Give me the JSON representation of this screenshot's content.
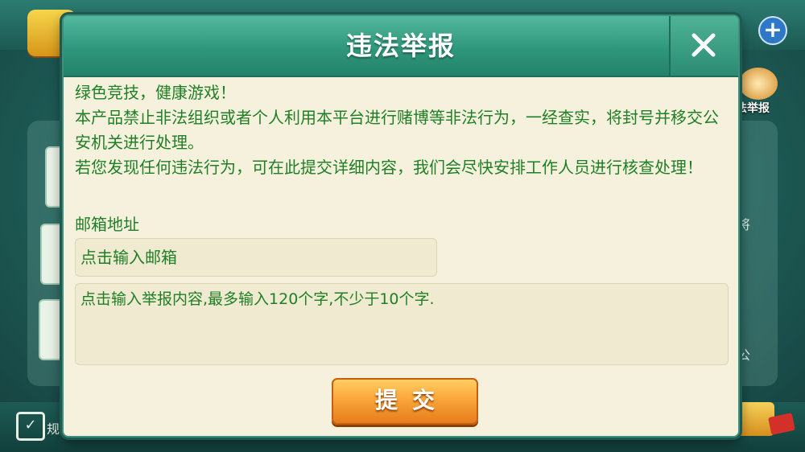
{
  "dialog": {
    "title": "违法举报",
    "intro_lines": [
      "绿色竞技，健康游戏！",
      "本产品禁止非法组织或者个人利用本平台进行赌博等非法行为，一经查实，将封号并移交公安机关进行处理。",
      "若您发现任何违法行为，可在此提交详细内容，我们会尽快安排工作人员进行核查处理！"
    ],
    "email_label": "邮箱地址",
    "email_placeholder": "点击输入邮箱",
    "report_placeholder": "点击输入举报内容,最多输入120个字,不少于10个字.",
    "submit_label": "提交"
  },
  "background": {
    "top_right_label": "法举报",
    "side_label_1": "将",
    "side_label_2": "公",
    "bottom_label": "规"
  },
  "colors": {
    "header_green": "#2f977c",
    "body_text_green": "#1f7f26",
    "dialog_bg": "#f6f1dd",
    "submit_orange": "#f9a63a"
  },
  "icons": {
    "close": "close-icon",
    "add": "plus-icon",
    "calendar": "calendar-icon",
    "cart": "cart-icon"
  }
}
